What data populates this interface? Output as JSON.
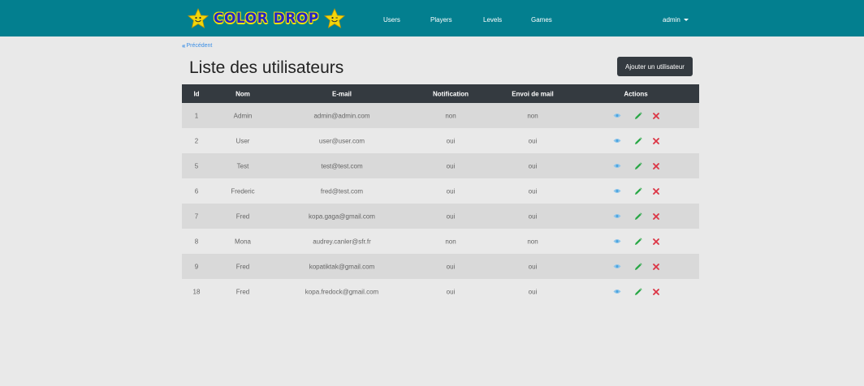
{
  "brand": {
    "title": "COLOR DROP"
  },
  "nav": {
    "links": [
      "Users",
      "Players",
      "Levels",
      "Games"
    ],
    "user": "admin"
  },
  "back": {
    "label": "Précédent"
  },
  "page": {
    "title": "Liste des utilisateurs",
    "add_label": "Ajouter un utilisateur"
  },
  "table": {
    "headers": {
      "id": "Id",
      "nom": "Nom",
      "email": "E-mail",
      "notification": "Notification",
      "envoi": "Envoi de mail",
      "actions": "Actions"
    },
    "rows": [
      {
        "id": "1",
        "nom": "Admin",
        "email": "admin@admin.com",
        "notification": "non",
        "envoi": "non"
      },
      {
        "id": "2",
        "nom": "User",
        "email": "user@user.com",
        "notification": "oui",
        "envoi": "oui"
      },
      {
        "id": "5",
        "nom": "Test",
        "email": "test@test.com",
        "notification": "oui",
        "envoi": "oui"
      },
      {
        "id": "6",
        "nom": "Frederic",
        "email": "fred@test.com",
        "notification": "oui",
        "envoi": "oui"
      },
      {
        "id": "7",
        "nom": "Fred",
        "email": "kopa.gaga@gmail.com",
        "notification": "oui",
        "envoi": "oui"
      },
      {
        "id": "8",
        "nom": "Mona",
        "email": "audrey.canler@sfr.fr",
        "notification": "non",
        "envoi": "non"
      },
      {
        "id": "9",
        "nom": "Fred",
        "email": "kopatiktak@gmail.com",
        "notification": "oui",
        "envoi": "oui"
      },
      {
        "id": "18",
        "nom": "Fred",
        "email": "kopa.fredock@gmail.com",
        "notification": "oui",
        "envoi": "oui"
      }
    ],
    "action_icons": [
      "eye-icon",
      "pencil-icon",
      "close-icon"
    ]
  },
  "colors": {
    "navbar": "#037f8f",
    "dark": "#343a40",
    "view": "#4aa3df",
    "edit": "#28a745",
    "delete": "#dc3545"
  }
}
